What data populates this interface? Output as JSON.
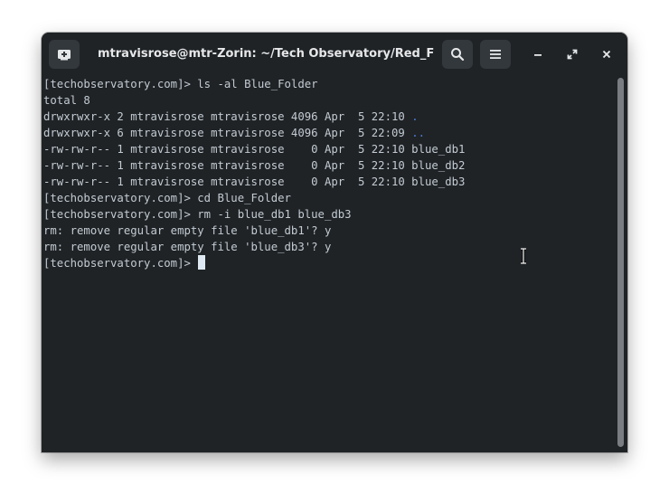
{
  "window": {
    "title": "mtravisrose@mtr-Zorin: ~/Tech Observatory/Red_Fol…"
  },
  "icons": {
    "new_tab": "new-tab-icon",
    "search": "search-icon",
    "menu": "hamburger-menu-icon",
    "minimize": "minimize-icon",
    "maximize": "maximize-icon",
    "close": "close-icon"
  },
  "colors": {
    "background": "#1f2326",
    "text": "#c3cbd3",
    "directory": "#4f7bd6",
    "cursor": "#dfe9f3"
  },
  "terminal": {
    "line1": "[techobservatory.com]> ls -al Blue_Folder",
    "line2": "total 8",
    "line3_prefix": "drwxrwxr-x 2 mtravisrose mtravisrose 4096 Apr  5 22:10 ",
    "line3_name": ".",
    "line4_prefix": "drwxrwxr-x 6 mtravisrose mtravisrose 4096 Apr  5 22:09 ",
    "line4_name": "..",
    "line5": "-rw-rw-r-- 1 mtravisrose mtravisrose    0 Apr  5 22:10 blue_db1",
    "line6": "-rw-rw-r-- 1 mtravisrose mtravisrose    0 Apr  5 22:10 blue_db2",
    "line7": "-rw-rw-r-- 1 mtravisrose mtravisrose    0 Apr  5 22:10 blue_db3",
    "line8": "[techobservatory.com]> cd Blue_Folder",
    "line9": "[techobservatory.com]> rm -i blue_db1 blue_db3",
    "line10": "rm: remove regular empty file 'blue_db1'? y",
    "line11": "rm: remove regular empty file 'blue_db3'? y",
    "prompt": "[techobservatory.com]> "
  }
}
